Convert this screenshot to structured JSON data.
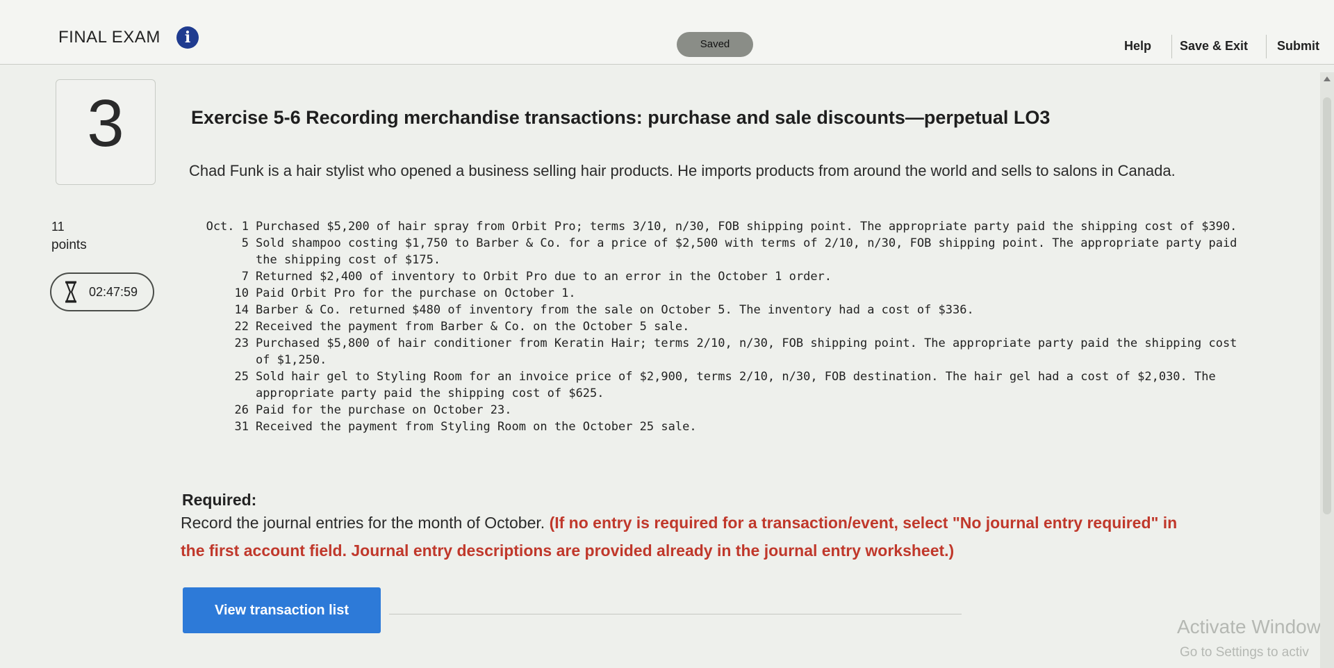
{
  "header": {
    "exam_title": "FINAL EXAM",
    "info_icon": "i",
    "saved_status": "Saved",
    "help": "Help",
    "save_exit": "Save & Exit",
    "submit": "Submit"
  },
  "sidebar": {
    "question_number": "3",
    "points_value": "11",
    "points_label": "points",
    "timer": "02:47:59"
  },
  "exercise": {
    "title": "Exercise 5-6 Recording merchandise transactions: purchase and sale discounts—perpetual LO3",
    "intro": "Chad Funk is a hair stylist who opened a business selling hair products. He imports products from around the world and sells to salons in Canada."
  },
  "transactions": [
    {
      "date": "Oct. 1",
      "text": "Purchased $5,200 of hair spray from Orbit Pro; terms 3/10, n/30, FOB shipping point. The appropriate party paid the shipping cost of $390."
    },
    {
      "date": "5",
      "text": "Sold shampoo costing $1,750 to Barber & Co. for a price of $2,500 with terms of 2/10, n/30, FOB shipping point. The appropriate party paid the shipping cost of $175."
    },
    {
      "date": "7",
      "text": "Returned $2,400 of inventory to Orbit Pro due to an error in the October 1 order."
    },
    {
      "date": "10",
      "text": "Paid Orbit Pro for the purchase on October 1."
    },
    {
      "date": "14",
      "text": "Barber & Co. returned $480 of inventory from the sale on October 5. The inventory had a cost of $336."
    },
    {
      "date": "22",
      "text": "Received the payment from Barber & Co. on the October 5 sale."
    },
    {
      "date": "23",
      "text": "Purchased $5,800 of hair conditioner from Keratin Hair; terms 2/10, n/30, FOB shipping point. The appropriate party paid the shipping cost of $1,250."
    },
    {
      "date": "25",
      "text": "Sold hair gel to Styling Room for an invoice price of $2,900, terms 2/10, n/30, FOB destination. The hair gel had a cost of $2,030. The appropriate party paid the shipping cost of $625."
    },
    {
      "date": "26",
      "text": "Paid for the purchase on October 23."
    },
    {
      "date": "31",
      "text": "Received the payment from Styling Room on the October 25 sale."
    }
  ],
  "required": {
    "label": "Required:",
    "text": "Record the journal entries for the month of October.",
    "note": "(If no entry is required for a transaction/event, select \"No journal entry required\" in the first account field. Journal entry descriptions are provided already in the journal entry worksheet.)"
  },
  "button": {
    "view_transactions": "View transaction list"
  },
  "overlay": {
    "activate_title": "Activate Window",
    "activate_sub": "Go to Settings to activ"
  },
  "colors": {
    "accent_blue": "#2d7ad8",
    "info_blue": "#1f3b8f",
    "required_red": "#c0382b"
  }
}
